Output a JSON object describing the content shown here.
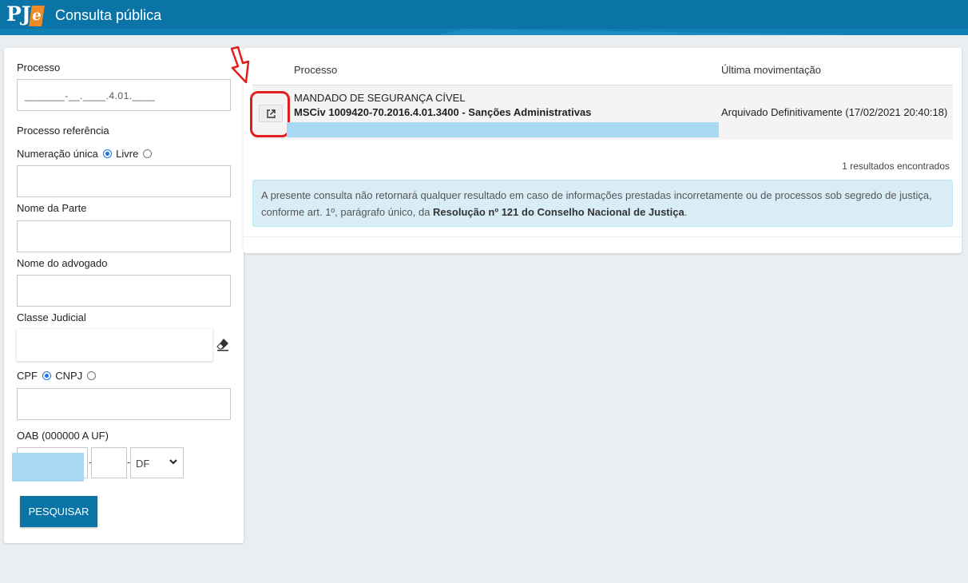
{
  "header": {
    "logo_text": "PJe",
    "title": "Consulta pública"
  },
  "form": {
    "processo_label": "Processo",
    "processo_mask": "_______-__.____.4.01.____",
    "processo_referencia_label": "Processo referência",
    "numeracao_unica_label": "Numeração única",
    "livre_label": "Livre",
    "nome_parte_label": "Nome da Parte",
    "nome_advogado_label": "Nome do advogado",
    "classe_judicial_label": "Classe Judicial",
    "cpf_label": "CPF",
    "cnpj_label": "CNPJ",
    "oab_label": "OAB (000000 A UF)",
    "oab_uf_selected": "DF",
    "search_button": "PESQUISAR"
  },
  "results": {
    "col_processo": "Processo",
    "col_ultima_movimentacao": "Última movimentação",
    "rows": [
      {
        "classe": "MANDADO DE SEGURANÇA CÍVEL",
        "numero": "MSCiv 1009420-70.2016.4.01.3400 - Sanções Administrativas",
        "ultima_movimentacao": "Arquivado Definitivamente (17/02/2021 20:40:18)"
      }
    ],
    "count_text": "1 resultados encontrados",
    "notice_text": "A presente consulta não retornará qualquer resultado em caso de informações prestadas incorretamente ou de processos sob segredo de justiça, conforme art. 1º, parágrafo único, da ",
    "notice_bold": "Resolução nº 121 do Conselho Nacional de Justiça",
    "notice_end": "."
  },
  "colors": {
    "header_blue": "#0a74a6",
    "accent_orange": "#f08a24",
    "annotation_red": "#e01f1f",
    "redaction_blue": "#a8daf5"
  }
}
